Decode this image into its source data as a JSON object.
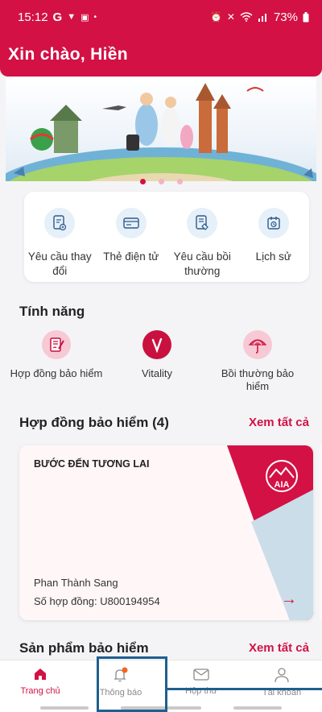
{
  "status_bar": {
    "time": "15:12",
    "battery": "73%"
  },
  "header": {
    "greeting": "Xin chào, Hiền"
  },
  "banner": {
    "slides": 3,
    "active_slide": 1
  },
  "quick_actions": [
    {
      "label": "Yêu cầu thay đổi",
      "icon": "request-change-icon"
    },
    {
      "label": "Thẻ điện tử",
      "icon": "e-card-icon"
    },
    {
      "label": "Yêu cầu bồi thường",
      "icon": "claim-request-icon"
    },
    {
      "label": "Lịch sử",
      "icon": "history-icon"
    }
  ],
  "features": {
    "title": "Tính năng",
    "items": [
      {
        "label": "Hợp đồng bảo hiểm",
        "icon": "contract-icon"
      },
      {
        "label": "Vitality",
        "icon": "vitality-icon"
      },
      {
        "label": "Bồi thường bảo hiểm",
        "icon": "umbrella-icon"
      }
    ]
  },
  "contracts": {
    "title": "Hợp đồng bảo hiểm (4)",
    "see_all": "Xem tất cả",
    "card": {
      "product": "BƯỚC ĐẾN TƯƠNG LAI",
      "holder": "Phan Thành Sang",
      "number": "Số hợp đồng: U800194954",
      "brand": "AIA"
    }
  },
  "products": {
    "title": "Sản phẩm bảo hiểm",
    "see_all": "Xem tất cả"
  },
  "bottom_nav": [
    {
      "label": "Trang chủ",
      "icon": "home-icon",
      "active": true
    },
    {
      "label": "Thông báo",
      "icon": "bell-icon",
      "active": false
    },
    {
      "label": "Hộp thư",
      "icon": "mail-icon",
      "active": false
    },
    {
      "label": "Tài khoản",
      "icon": "user-icon",
      "active": false
    }
  ],
  "colors": {
    "brand": "#d31145",
    "icon_bg": "#e6f0f8",
    "highlight": "#1f5f8f"
  }
}
